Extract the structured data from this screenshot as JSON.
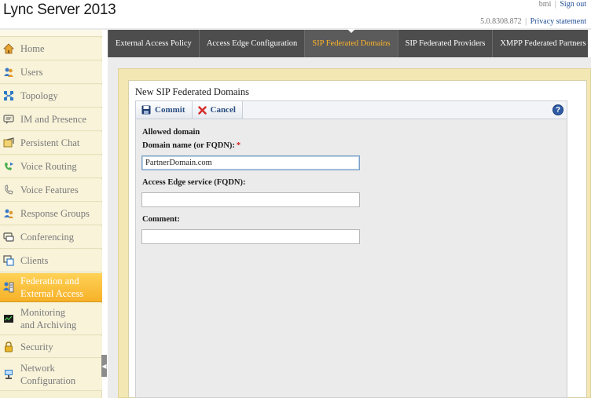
{
  "app": {
    "title": "Lync Server 2013"
  },
  "header": {
    "user": "bmi",
    "sign_out": "Sign out",
    "version": "5.0.8308.872",
    "privacy": "Privacy statement",
    "separator": "|"
  },
  "sidebar": {
    "items": [
      {
        "label": "Home",
        "icon": "home-icon"
      },
      {
        "label": "Users",
        "icon": "users-icon"
      },
      {
        "label": "Topology",
        "icon": "topology-icon"
      },
      {
        "label": "IM and Presence",
        "icon": "im-presence-icon"
      },
      {
        "label": "Persistent Chat",
        "icon": "persistent-chat-icon"
      },
      {
        "label": "Voice Routing",
        "icon": "voice-routing-icon"
      },
      {
        "label": "Voice Features",
        "icon": "voice-features-icon"
      },
      {
        "label": "Response Groups",
        "icon": "response-groups-icon"
      },
      {
        "label": "Conferencing",
        "icon": "conferencing-icon"
      },
      {
        "label": "Clients",
        "icon": "clients-icon"
      },
      {
        "label": "Federation and External Access",
        "line1": "Federation and",
        "line2": "External Access",
        "icon": "federation-icon",
        "active": true
      },
      {
        "label": "Monitoring and Archiving",
        "line1": "Monitoring",
        "line2": "and Archiving",
        "icon": "monitoring-icon"
      },
      {
        "label": "Security",
        "icon": "security-lock-icon"
      },
      {
        "label": "Network Configuration",
        "line1": "Network",
        "line2": "Configuration",
        "icon": "network-icon"
      }
    ]
  },
  "tabs": [
    {
      "label": "External Access Policy"
    },
    {
      "label": "Access Edge Configuration"
    },
    {
      "label": "SIP Federated Domains",
      "active": true
    },
    {
      "label": "SIP Federated Providers"
    },
    {
      "label": "XMPP Federated Partners"
    }
  ],
  "panel": {
    "title": "New SIP Federated Domains",
    "toolbar": {
      "commit": "Commit",
      "cancel": "Cancel",
      "help": "?"
    },
    "section": "Allowed domain",
    "fields": {
      "domain_label": "Domain name (or FQDN):",
      "required_mark": "*",
      "domain_value": "PartnerDomain.com",
      "edge_label": "Access Edge service (FQDN):",
      "edge_value": "",
      "comment_label": "Comment:",
      "comment_value": ""
    }
  },
  "colors": {
    "accent": "#f6b128",
    "tabbar": "#4d4d4d",
    "active_tab_text": "#ffb52b",
    "link": "#1f4e94",
    "required": "#d21a1a"
  }
}
